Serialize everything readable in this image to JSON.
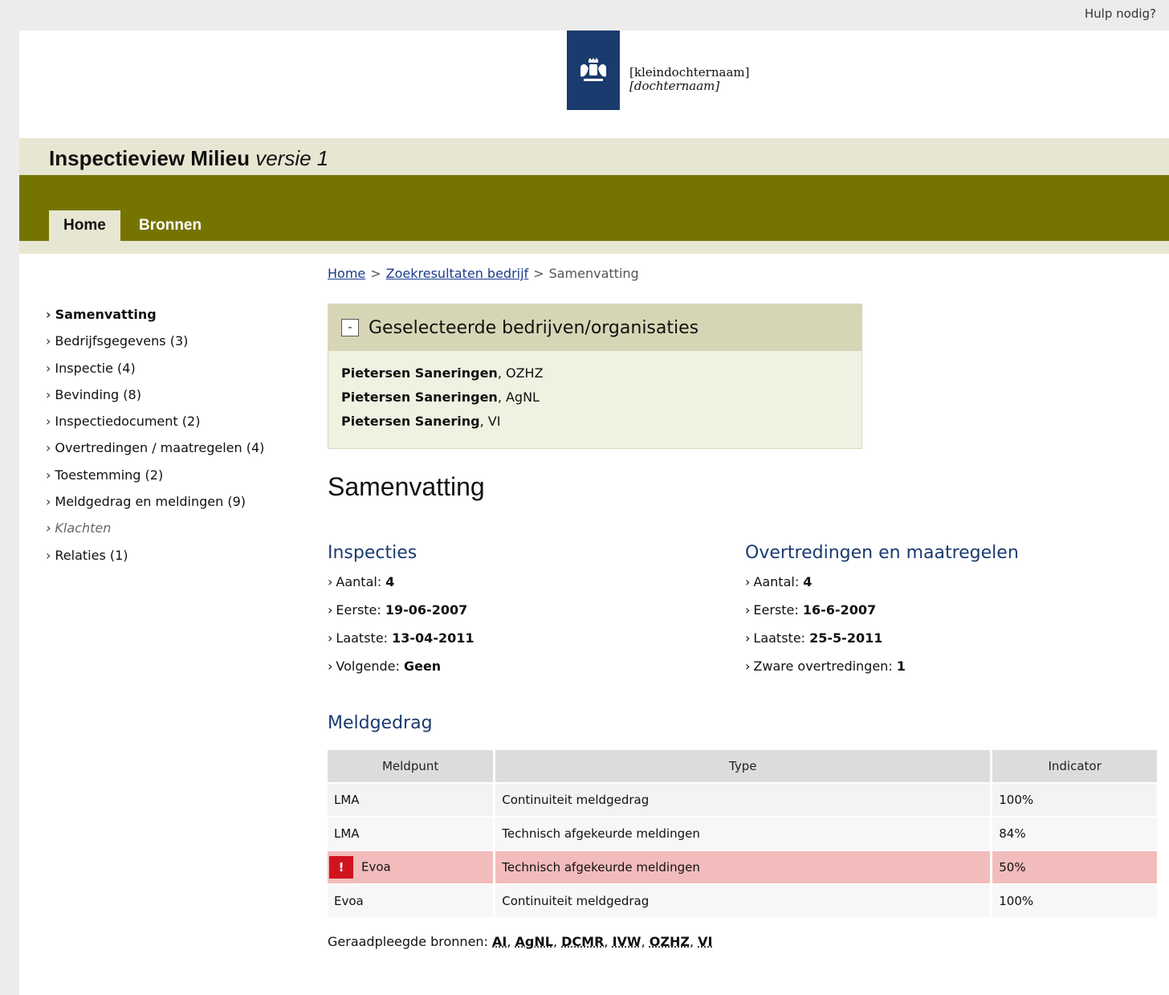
{
  "topbar": {
    "help": "Hulp nodig?"
  },
  "brand": {
    "line1": "[kleindochternaam]",
    "line2": "[dochternaam]"
  },
  "app": {
    "title": "Inspectieview Milieu",
    "version": "versie 1"
  },
  "nav": {
    "tabs": [
      {
        "label": "Home",
        "active": true
      },
      {
        "label": "Bronnen",
        "active": false
      }
    ]
  },
  "breadcrumb": {
    "home": "Home",
    "results": "Zoekresultaten bedrijf",
    "current": "Samenvatting",
    "sep": ">"
  },
  "sidebar": {
    "items": [
      {
        "label": "Samenvatting"
      },
      {
        "label": "Bedrijfsgegevens (3)"
      },
      {
        "label": "Inspectie (4)"
      },
      {
        "label": "Bevinding (8)"
      },
      {
        "label": "Inspectiedocument (2)"
      },
      {
        "label": "Overtredingen / maatregelen (4)"
      },
      {
        "label": "Toestemming (2)"
      },
      {
        "label": "Meldgedrag en meldingen (9)"
      },
      {
        "label": "Klachten"
      },
      {
        "label": "Relaties (1)"
      }
    ]
  },
  "selection": {
    "toggle": "-",
    "title": "Geselecteerde bedrijven/organisaties",
    "companies": [
      {
        "name": "Pietersen Saneringen",
        "org": ", OZHZ"
      },
      {
        "name": "Pietersen Saneringen",
        "org": ", AgNL"
      },
      {
        "name": "Pietersen Sanering",
        "org": ", VI"
      }
    ]
  },
  "summary": {
    "title": "Samenvatting"
  },
  "inspections": {
    "title": "Inspecties",
    "items": [
      {
        "label": "Aantal: ",
        "value": "4"
      },
      {
        "label": "Eerste: ",
        "value": "19-06-2007"
      },
      {
        "label": "Laatste: ",
        "value": "13-04-2011"
      },
      {
        "label": "Volgende: ",
        "value": "Geen"
      }
    ]
  },
  "violations": {
    "title": "Overtredingen en maatregelen",
    "items": [
      {
        "label": "Aantal: ",
        "value": "4"
      },
      {
        "label": "Eerste: ",
        "value": "16-6-2007"
      },
      {
        "label": "Laatste: ",
        "value": "25-5-2011"
      },
      {
        "label": "Zware overtredingen: ",
        "value": "1"
      }
    ]
  },
  "meldgedrag": {
    "title": "Meldgedrag",
    "columns": [
      "Meldpunt",
      "Type",
      "Indicator"
    ],
    "rows": [
      {
        "meldpunt": "LMA",
        "type": "Continuiteit meldgedrag",
        "indicator": "100%"
      },
      {
        "meldpunt": "LMA",
        "type": "Technisch afgekeurde meldingen",
        "indicator": "84%"
      },
      {
        "meldpunt": "Evoa",
        "type": "Technisch afgekeurde meldingen",
        "indicator": "50%",
        "alert_icon": "!"
      },
      {
        "meldpunt": "Evoa",
        "type": "Continuiteit meldgedrag",
        "indicator": "100%"
      }
    ]
  },
  "sources": {
    "label": "Geraadpleegde bronnen: ",
    "items": [
      "AI",
      "AgNL",
      "DCMR",
      "IVW",
      "OZHZ",
      "VI"
    ]
  },
  "colors": {
    "olive": "#767400",
    "beige": "#e7e6d2",
    "navy": "#1a3b6e",
    "alert": "#d0141e"
  }
}
